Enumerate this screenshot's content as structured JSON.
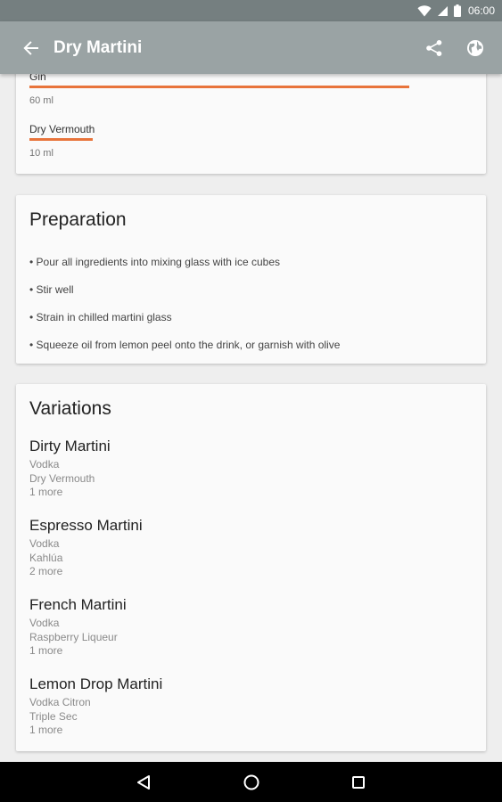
{
  "status_bar": {
    "time": "06:00"
  },
  "app_bar": {
    "title": "Dry Martini"
  },
  "ingredients": [
    {
      "name": "Gin",
      "amount": "60 ml",
      "proportion": 0.857
    },
    {
      "name": "Dry Vermouth",
      "amount": "10 ml",
      "proportion": 0.143
    }
  ],
  "preparation": {
    "title": "Preparation",
    "steps": [
      "• Pour all ingredients into mixing glass with ice cubes",
      "• Stir well",
      "• Strain in chilled martini glass",
      "• Squeeze oil from lemon peel onto the drink, or garnish with olive"
    ]
  },
  "variations": {
    "title": "Variations",
    "items": [
      {
        "name": "Dirty Martini",
        "lines": [
          "Vodka",
          "Dry Vermouth",
          "1 more"
        ]
      },
      {
        "name": "Espresso Martini",
        "lines": [
          "Vodka",
          "Kahlúa",
          "2 more"
        ]
      },
      {
        "name": "French Martini",
        "lines": [
          "Vodka",
          "Raspberry Liqueur",
          "1 more"
        ]
      },
      {
        "name": "Lemon Drop Martini",
        "lines": [
          "Vodka Citron",
          "Triple Sec",
          "1 more"
        ]
      }
    ]
  },
  "colors": {
    "accent": "#e8743b",
    "app_bar": "#9aa3a4",
    "status_bar": "#757f80"
  },
  "icons": [
    "wifi-icon",
    "signal-icon",
    "battery-icon",
    "back-arrow-icon",
    "share-icon",
    "globe-icon",
    "nav-back-icon",
    "nav-home-icon",
    "nav-recents-icon"
  ]
}
